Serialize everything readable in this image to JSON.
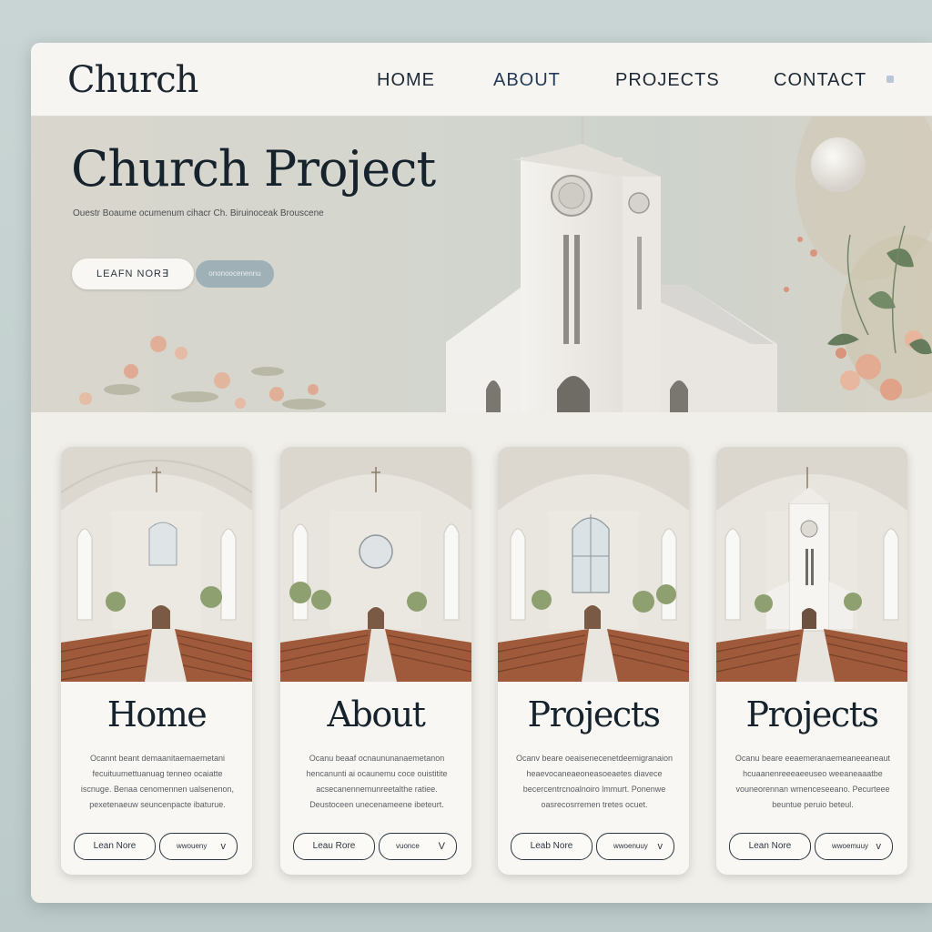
{
  "colors": {
    "accent": "#233a58",
    "text": "#17232c",
    "background": "#f1efea",
    "secondary_button": "#9fb0b6"
  },
  "navbar": {
    "logo": "Church",
    "items": [
      {
        "label": "HOME"
      },
      {
        "label": "ABOUT"
      },
      {
        "label": "PROJECTS"
      },
      {
        "label": "CONTACT"
      }
    ]
  },
  "hero": {
    "title": "Church Project",
    "subtitle": "Ouestr Boaume ocumenum cihacr Ch. Biruinoceak Brouscene",
    "primary_button": "LEAFN NOR∃",
    "secondary_button": "ononoocenennu",
    "image": "church-exterior-illustration"
  },
  "cards": [
    {
      "title": "Home",
      "body": "Ocannt beant demaanitaemaemetani fecuituumettuanuag tenneo ocaiatte iscnuge. Benaa cenomennen ualsenenon, pexetenaeuw seuncenpacte ibaturue.",
      "primary_button": "Lean Nore",
      "secondary_button": "wwoueny",
      "chevron": "v"
    },
    {
      "title": "About",
      "body": "Ocanu beaaf ocnaununanaemetanon hencanunti ai ocaunemu coce ouistitite acsecanennemunreetalthe ratiee. Deustoceen unecenameene ibeteurt.",
      "primary_button": "Leau Rore",
      "secondary_button": "vuonce",
      "chevron": "V"
    },
    {
      "title": "Projects",
      "body": "Ocanv beare oeaisenecenetdeemigranaion heaevocaneaeoneasoeaetes diavece becercentrcnoalnoiro lmmurt. Ponenwe oasrecosrremen tretes ocuet.",
      "primary_button": "Leab Nore",
      "secondary_button": "wwoenuuy",
      "chevron": "v"
    },
    {
      "title": "Projects",
      "body": "Ocanu beare eeaemeranaemeaneeaneaut hcuaanenreeeaeeuseo weeaneaaatbe vouneorennan wmenceseeano. Pecurteee beuntue peruio beteul.",
      "primary_button": "Lean Nore",
      "secondary_button": "wwoemuuy",
      "chevron": "v"
    }
  ]
}
